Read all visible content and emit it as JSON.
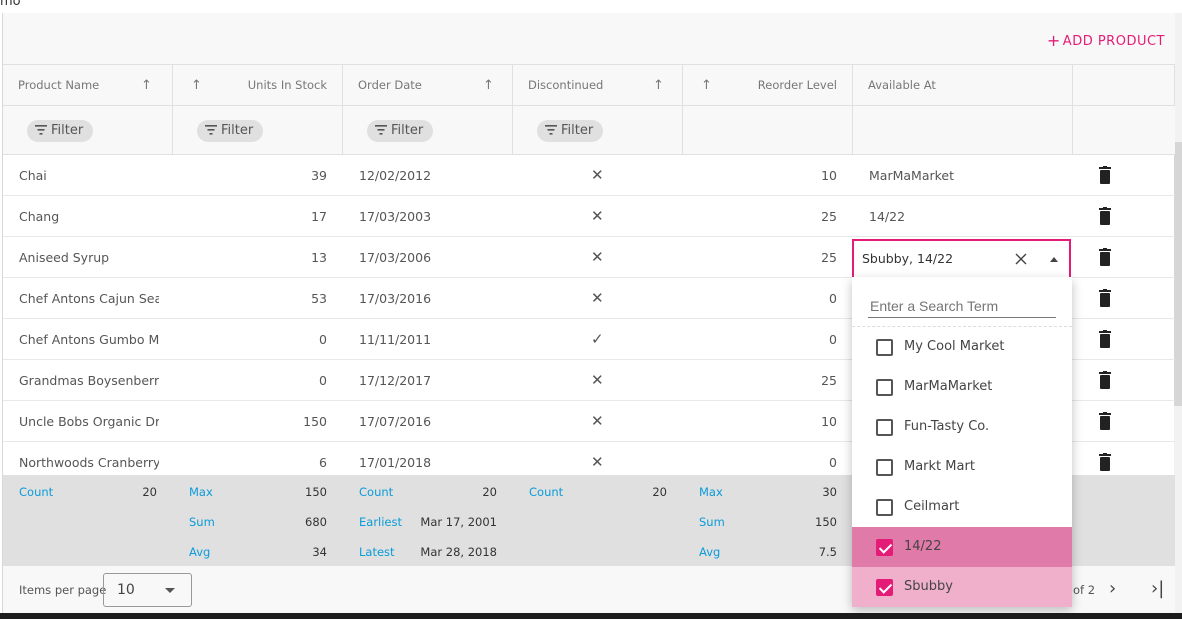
{
  "demo_label": "emo",
  "toolbar": {
    "add_label": "ADD PRODUCT",
    "add_icon": "+"
  },
  "columns": [
    {
      "label": "Product Name",
      "sortable": true,
      "sort_icon": "↑"
    },
    {
      "label": "Units In Stock",
      "sortable": true,
      "sort_icon": "↑"
    },
    {
      "label": "Order Date",
      "sortable": true,
      "sort_icon": "↑"
    },
    {
      "label": "Discontinued",
      "sortable": true,
      "sort_icon": "↑"
    },
    {
      "label": "Reorder Level",
      "sortable": true,
      "sort_icon": "↑"
    },
    {
      "label": "Available At",
      "sortable": false
    }
  ],
  "filter_label": "Filter",
  "rows": [
    {
      "name": "Chai",
      "units": "39",
      "date": "12/02/2012",
      "discontinued": "✕",
      "reorder": "10",
      "available": "MarMaMarket"
    },
    {
      "name": "Chang",
      "units": "17",
      "date": "17/03/2003",
      "discontinued": "✕",
      "reorder": "25",
      "available": "14/22"
    },
    {
      "name": "Aniseed Syrup",
      "units": "13",
      "date": "17/03/2006",
      "discontinued": "✕",
      "reorder": "25",
      "available": ""
    },
    {
      "name": "Chef Antons Cajun Sea…",
      "units": "53",
      "date": "17/03/2016",
      "discontinued": "✕",
      "reorder": "0",
      "available": ""
    },
    {
      "name": "Chef Antons Gumbo Mix",
      "units": "0",
      "date": "11/11/2011",
      "discontinued": "✓",
      "reorder": "0",
      "available": ""
    },
    {
      "name": "Grandmas Boysenberry…",
      "units": "0",
      "date": "17/12/2017",
      "discontinued": "✕",
      "reorder": "25",
      "available": ""
    },
    {
      "name": "Uncle Bobs Organic Dri…",
      "units": "150",
      "date": "17/07/2016",
      "discontinued": "✕",
      "reorder": "10",
      "available": ""
    },
    {
      "name": "Northwoods Cranberry …",
      "units": "6",
      "date": "17/01/2018",
      "discontinued": "✕",
      "reorder": "0",
      "available": ""
    }
  ],
  "summary": {
    "name_count_label": "Count",
    "name_count": "20",
    "units_max_label": "Max",
    "units_max": "150",
    "units_sum_label": "Sum",
    "units_sum": "680",
    "units_avg_label": "Avg",
    "units_avg": "34",
    "date_count_label": "Count",
    "date_count": "20",
    "date_earliest_label": "Earliest",
    "date_earliest": "Mar 17, 2001",
    "date_latest_label": "Latest",
    "date_latest": "Mar 28, 2018",
    "disc_count_label": "Count",
    "disc_count": "20",
    "reorder_max_label": "Max",
    "reorder_max": "30",
    "reorder_sum_label": "Sum",
    "reorder_sum": "150",
    "reorder_avg_label": "Avg",
    "reorder_avg": "7.5"
  },
  "pager": {
    "items_per_page_label": "Items per page",
    "items_per_page": "10",
    "of_text": "of 2",
    "next_icon": "›",
    "last_icon": "›|"
  },
  "editor": {
    "value": "Sbubby, 14/22"
  },
  "dropdown": {
    "search_placeholder": "Enter a Search Term",
    "options": [
      {
        "label": "My Cool Market",
        "checked": false
      },
      {
        "label": "MarMaMarket",
        "checked": false
      },
      {
        "label": "Fun-Tasty Co.",
        "checked": false
      },
      {
        "label": "Markt Mart",
        "checked": false
      },
      {
        "label": "Ceilmart",
        "checked": false
      },
      {
        "label": "14/22",
        "checked": true
      },
      {
        "label": "Sbubby",
        "checked": true
      }
    ]
  },
  "colors": {
    "accent": "#e41c77",
    "summary_label": "#0b9bd8",
    "summary_bg": "#e0e0e0",
    "selected_option": "#e07aa8",
    "hover_option": "#f0b0cc"
  }
}
